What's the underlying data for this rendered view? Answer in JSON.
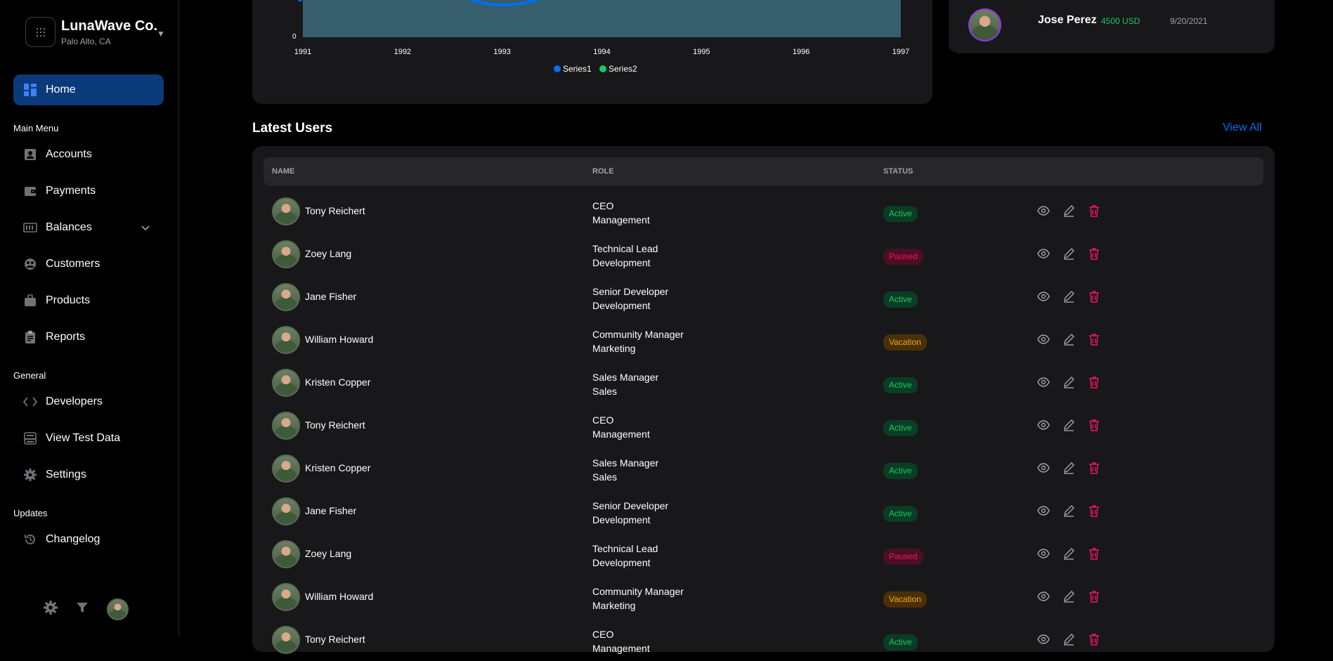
{
  "brand": {
    "name": "LunaWave Co.",
    "location": "Palo Alto, CA"
  },
  "nav": {
    "home": "Home",
    "main_menu_title": "Main Menu",
    "main_menu": [
      {
        "label": "Accounts",
        "icon": "accounts-icon"
      },
      {
        "label": "Payments",
        "icon": "wallet-icon"
      },
      {
        "label": "Balances",
        "icon": "balance-icon"
      },
      {
        "label": "Customers",
        "icon": "customers-icon"
      },
      {
        "label": "Products",
        "icon": "briefcase-icon"
      },
      {
        "label": "Reports",
        "icon": "clipboard-icon"
      }
    ],
    "general_title": "General",
    "general": [
      {
        "label": "Developers",
        "icon": "code-icon"
      },
      {
        "label": "View Test Data",
        "icon": "test-data-icon"
      },
      {
        "label": "Settings",
        "icon": "settings-icon"
      }
    ],
    "updates_title": "Updates",
    "updates": [
      {
        "label": "Changelog",
        "icon": "history-icon"
      }
    ]
  },
  "colors": {
    "accent": "#006FEE",
    "active_nav": "#0b3a7a",
    "card_bg": "#18181b",
    "series1": "#006FEE",
    "series2": "#17c964"
  },
  "chart_data": {
    "type": "area",
    "x": [
      "1991",
      "1992",
      "1993",
      "1994",
      "1995",
      "1996",
      "1997"
    ],
    "y_tick_visible": "0",
    "series": [
      {
        "name": "Series1"
      },
      {
        "name": "Series2"
      }
    ],
    "legend_position": "bottom"
  },
  "transaction": {
    "name": "Jose Perez",
    "amount": "4500 USD",
    "date": "9/20/2021"
  },
  "latest_users": {
    "title": "Latest Users",
    "view_all": "View All",
    "columns": [
      "NAME",
      "ROLE",
      "STATUS"
    ],
    "rows": [
      {
        "name": "Tony Reichert",
        "role": "CEO",
        "team": "Management",
        "status": "Active"
      },
      {
        "name": "Zoey Lang",
        "role": "Technical Lead",
        "team": "Development",
        "status": "Paused"
      },
      {
        "name": "Jane Fisher",
        "role": "Senior Developer",
        "team": "Development",
        "status": "Active"
      },
      {
        "name": "William Howard",
        "role": "Community Manager",
        "team": "Marketing",
        "status": "Vacation"
      },
      {
        "name": "Kristen Copper",
        "role": "Sales Manager",
        "team": "Sales",
        "status": "Active"
      },
      {
        "name": "Tony Reichert",
        "role": "CEO",
        "team": "Management",
        "status": "Active"
      },
      {
        "name": "Kristen Copper",
        "role": "Sales Manager",
        "team": "Sales",
        "status": "Active"
      },
      {
        "name": "Jane Fisher",
        "role": "Senior Developer",
        "team": "Development",
        "status": "Active"
      },
      {
        "name": "Zoey Lang",
        "role": "Technical Lead",
        "team": "Development",
        "status": "Paused"
      },
      {
        "name": "William Howard",
        "role": "Community Manager",
        "team": "Marketing",
        "status": "Vacation"
      },
      {
        "name": "Tony Reichert",
        "role": "CEO",
        "team": "Management",
        "status": "Active"
      }
    ]
  }
}
